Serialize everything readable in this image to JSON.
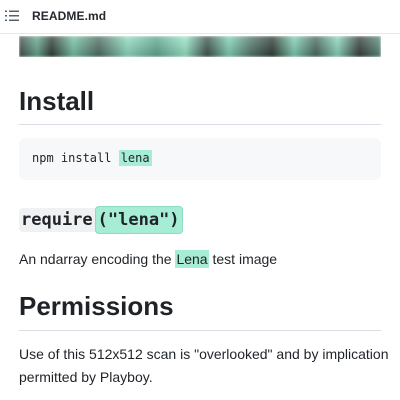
{
  "header": {
    "toc_icon": "list-unordered-icon",
    "file_name": "README.md"
  },
  "banner": {
    "description_colors": [
      "#3e4a44",
      "#8fdcc0",
      "#2e3933"
    ]
  },
  "sections": {
    "install": {
      "heading": "Install",
      "code_prefix": "npm install ",
      "code_package": "lena"
    },
    "require": {
      "keyword": "require",
      "argument": "(\"lena\")"
    },
    "description": {
      "before": "An ndarray encoding the ",
      "highlight": "Lena",
      "after": " test image"
    },
    "permissions": {
      "heading": "Permissions",
      "text": "Use of this 512x512 scan is \"overlooked\" and by implication permitted by Playboy."
    }
  },
  "colors": {
    "highlight": "#a7ecd4",
    "code_background": "#f6f8fa",
    "text": "#1f2328"
  }
}
